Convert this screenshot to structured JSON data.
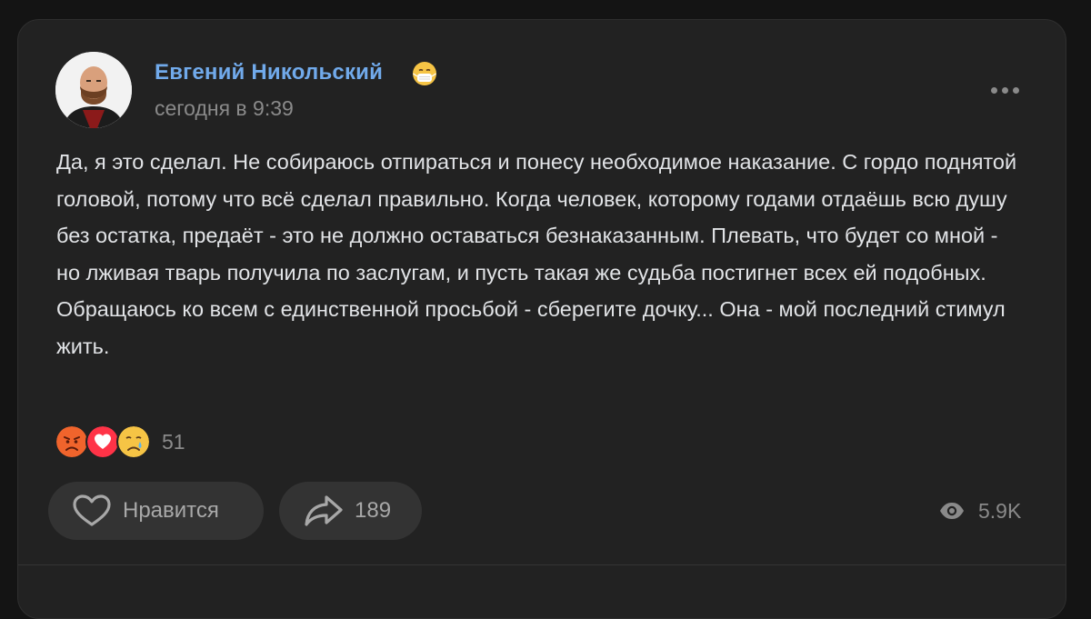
{
  "post": {
    "author_name": "Евгений Никольский",
    "time": "сегодня в 9:39",
    "text": "Да, я это сделал. Не собираюсь отпираться и понесу необходимое наказание. С гордо поднятой головой, потому что всё сделал правильно. Когда человек, которому годами отдаёшь всю душу без остатка, предаёт - это не должно оставаться безнаказанным. Плевать, что будет со мной - но лживая тварь получила по заслугам, и пусть такая же судьба постигнет всех ей подобных. Обращаюсь ко всем с единственной просьбой - сберегите дочку... Она - мой последний стимул жить.",
    "status_emoji": "mask-face-emoji"
  },
  "reactions": {
    "icons": [
      "angry-face-emoji",
      "heart-emoji",
      "crying-face-emoji"
    ],
    "count": "51"
  },
  "actions": {
    "like_label": "Нравится",
    "like_icon": "heart-outline-icon",
    "share_count": "189",
    "share_icon": "share-arrow-icon",
    "views_count": "5.9K",
    "views_icon": "eye-icon",
    "more_icon": "more-dots-icon"
  },
  "colors": {
    "background": "#141414",
    "card": "#222222",
    "author_link": "#71aaeb",
    "text": "#e1e3e6",
    "muted": "#8a8a8a",
    "button": "#333333"
  }
}
